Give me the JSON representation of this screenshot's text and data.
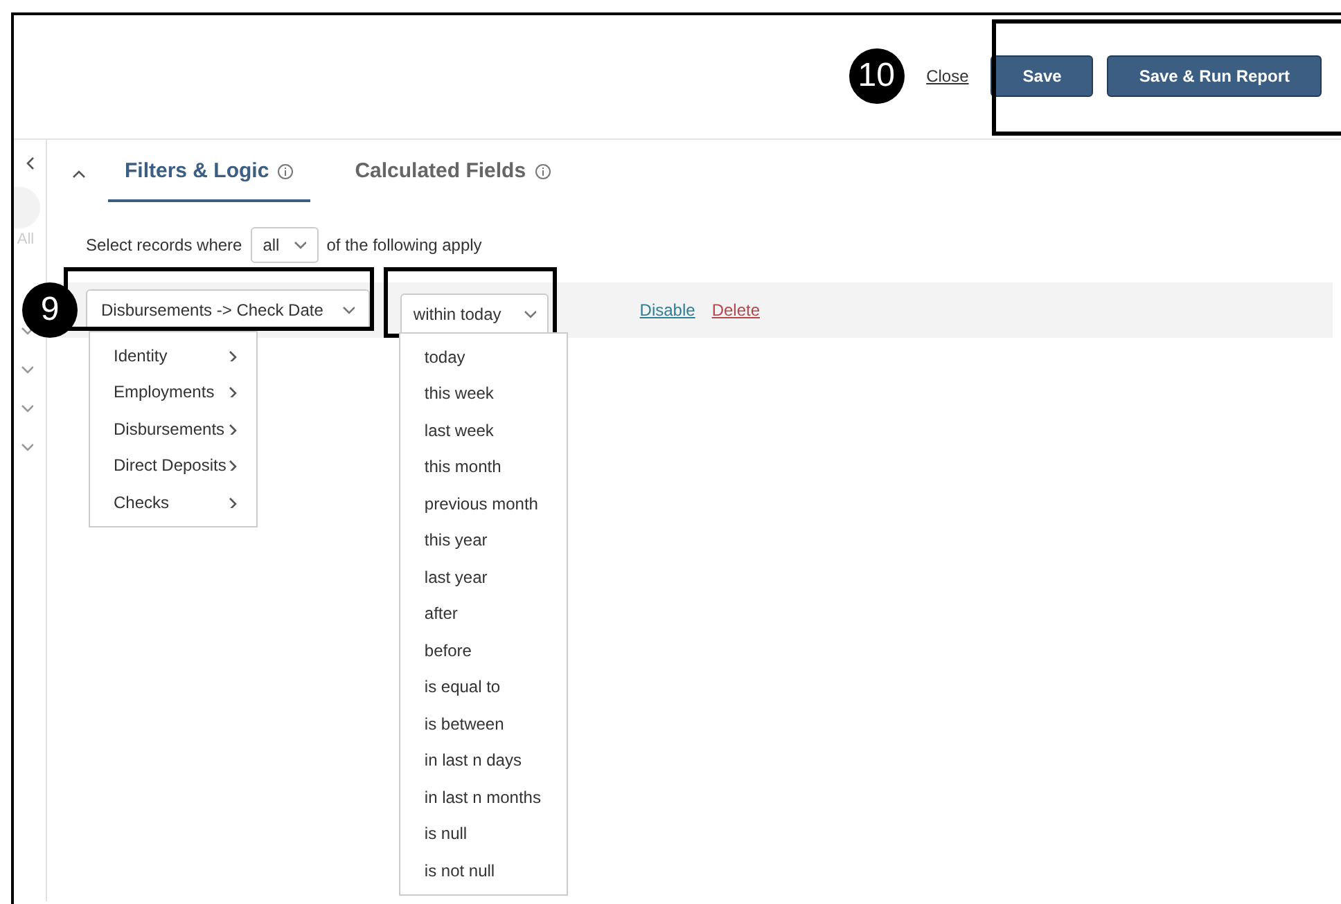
{
  "header": {
    "close_link": "Close",
    "buttons": [
      {
        "label": "Save"
      },
      {
        "label": "Save & Run Report"
      }
    ]
  },
  "callouts": [
    {
      "label": "10"
    },
    {
      "label": "9"
    }
  ],
  "sidebar": {
    "label": "All"
  },
  "tabs": [
    {
      "label": "Filters & Logic",
      "selected": true
    },
    {
      "label": "Calculated Fields",
      "selected": false
    }
  ],
  "filter_sentence": {
    "before": "Select records where",
    "match": "all",
    "after": "of the following apply"
  },
  "filters": [
    {
      "field": "Disbursements -> Check Date",
      "operator": "within today",
      "actions": [
        {
          "label": "Disable",
          "kind": "toggle"
        },
        {
          "label": "Delete",
          "kind": "remove"
        }
      ]
    }
  ],
  "field_menu": [
    "Identity",
    "Employments",
    "Disbursements",
    "Direct Deposits",
    "Checks"
  ],
  "operator_menu": [
    "today",
    "this week",
    "last week",
    "this month",
    "previous month",
    "this year",
    "last year",
    "after",
    "before",
    "is equal to",
    "is between",
    "in last n days",
    "in last n months",
    "is null",
    "is not null"
  ]
}
